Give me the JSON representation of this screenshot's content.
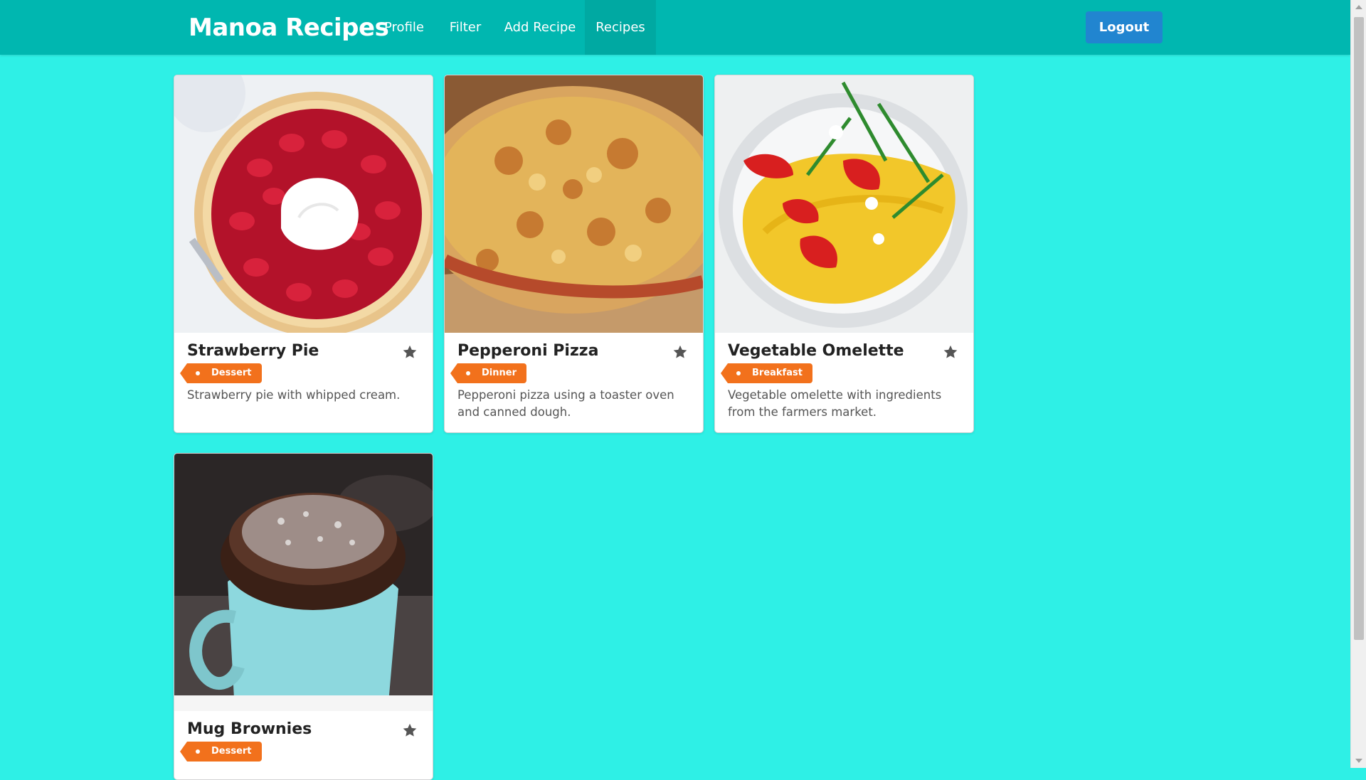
{
  "nav": {
    "brand": "Manoa Recipes",
    "items": [
      {
        "label": "Profile"
      },
      {
        "label": "Filter"
      },
      {
        "label": "Add Recipe"
      },
      {
        "label": "Recipes"
      }
    ],
    "logout_label": "Logout"
  },
  "recipes": [
    {
      "title": "Strawberry Pie",
      "tag": "Dessert",
      "description": "Strawberry pie with whipped cream."
    },
    {
      "title": "Pepperoni Pizza",
      "tag": "Dinner",
      "description": "Pepperoni pizza using a toaster oven and canned dough."
    },
    {
      "title": "Vegetable Omelette",
      "tag": "Breakfast",
      "description": "Vegetable omelette with ingredients from the farmers market."
    },
    {
      "title": "Mug Brownies",
      "tag": "Dessert",
      "description": ""
    }
  ],
  "colors": {
    "page_bg": "#2ef0e6",
    "navbar_bg": "#00b7b0",
    "logout_bg": "#2185d0",
    "tag_bg": "#f2711c"
  }
}
